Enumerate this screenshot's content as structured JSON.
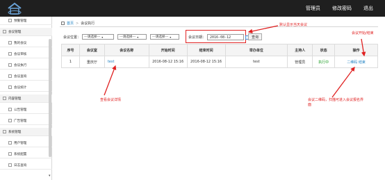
{
  "header": {
    "nav": [
      "管理员",
      "修改密码",
      "退出"
    ]
  },
  "sidebar": {
    "items": [
      {
        "label": "预警管理",
        "kind": "first"
      },
      {
        "label": "会议管理",
        "kind": "group"
      },
      {
        "label": "我的会议",
        "kind": "sub"
      },
      {
        "label": "会议审核",
        "kind": "sub"
      },
      {
        "label": "会议执行",
        "kind": "sub"
      },
      {
        "label": "会议查询",
        "kind": "sub"
      },
      {
        "label": "会议统计",
        "kind": "sub"
      },
      {
        "label": "内容管理",
        "kind": "group"
      },
      {
        "label": "公告管理",
        "kind": "sub"
      },
      {
        "label": "广告管理",
        "kind": "sub"
      },
      {
        "label": "系统管理",
        "kind": "group"
      },
      {
        "label": "用户管理",
        "kind": "sub"
      },
      {
        "label": "系统配置",
        "kind": "sub"
      },
      {
        "label": "日志查询",
        "kind": "sub"
      }
    ]
  },
  "breadcrumb": {
    "home": "首页",
    "sep": ">",
    "current": "会议执行"
  },
  "filters": {
    "location_label": "会议位置：",
    "placeholder": "---请选择---",
    "date_label": "会议日期：",
    "date_value": "2016-08-12",
    "query_button": "查询"
  },
  "table": {
    "headers": [
      "序号",
      "会议室",
      "会议名称",
      "开始时间",
      "结束时间",
      "举办单位",
      "主持人",
      "状态",
      "操作"
    ],
    "rows": [
      {
        "no": "1",
        "room": "重庆厅",
        "name": "test",
        "start": "2016-08-12 15:16",
        "end": "2016-08-12 15:16",
        "org": "test",
        "host": "管理员",
        "status": "执行中",
        "op_qr": "二维码",
        "op_end": "结束"
      }
    ]
  },
  "annotations": {
    "default_date": "默认显示当天会议",
    "start_end": "会议开始/结束",
    "view_detail": "查看会议详情",
    "qrcode_line1": "会议二维码，扫描可进入会议报名界",
    "qrcode_line2": "面"
  },
  "colors": {
    "header_bg": "#1f1f1f",
    "annotation_red": "#e02020",
    "link_blue": "#1a7fc1",
    "status_green": "#23a02a"
  }
}
